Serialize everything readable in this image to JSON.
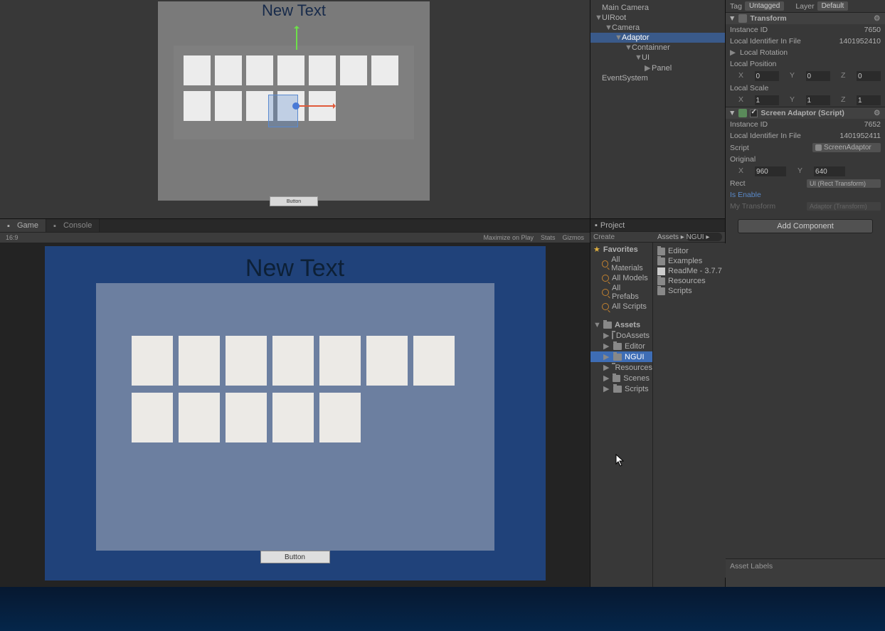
{
  "scene": {
    "title": "New Text",
    "button_label": "Button",
    "grid_rows": [
      7,
      5
    ]
  },
  "game": {
    "tabs": [
      {
        "label": "Game",
        "active": true
      },
      {
        "label": "Console",
        "active": false
      }
    ],
    "aspect": "16:9",
    "toolbar_right": [
      "Maximize on Play",
      "Stats",
      "Gizmos"
    ],
    "title": "New Text",
    "button_label": "Button",
    "grid_rows": [
      7,
      5
    ]
  },
  "hierarchy": [
    {
      "label": "Main Camera",
      "indent": 0,
      "expand": ""
    },
    {
      "label": "UIRoot",
      "indent": 0,
      "expand": "▼"
    },
    {
      "label": "Camera",
      "indent": 1,
      "expand": "▼"
    },
    {
      "label": "Adaptor",
      "indent": 2,
      "expand": "▼",
      "selected": true
    },
    {
      "label": "Containner",
      "indent": 3,
      "expand": "▼"
    },
    {
      "label": "UI",
      "indent": 4,
      "expand": "▼"
    },
    {
      "label": "Panel",
      "indent": 5,
      "expand": "▶"
    },
    {
      "label": "EventSystem",
      "indent": 0,
      "expand": ""
    }
  ],
  "project": {
    "tab": "Project",
    "create": "Create",
    "favorites_label": "Favorites",
    "favorites": [
      "All Materials",
      "All Models",
      "All Prefabs",
      "All Scripts"
    ],
    "assets_label": "Assets",
    "folders": [
      {
        "label": "DoAssets",
        "indent": 1
      },
      {
        "label": "Editor",
        "indent": 1
      },
      {
        "label": "NGUI",
        "indent": 1,
        "selected": true
      },
      {
        "label": "Resources",
        "indent": 1
      },
      {
        "label": "Scenes",
        "indent": 1
      },
      {
        "label": "Scripts",
        "indent": 1
      }
    ],
    "breadcrumb": [
      "Assets",
      "NGUI"
    ],
    "files": [
      {
        "label": "Editor",
        "type": "folder"
      },
      {
        "label": "Examples",
        "type": "folder"
      },
      {
        "label": "ReadMe - 3.7.7",
        "type": "doc"
      },
      {
        "label": "Resources",
        "type": "folder"
      },
      {
        "label": "Scripts",
        "type": "folder"
      }
    ]
  },
  "inspector": {
    "tag_label": "Tag",
    "tag_value": "Untagged",
    "layer_label": "Layer",
    "layer_value": "Default",
    "transform": {
      "header": "Transform",
      "instance_id_label": "Instance ID",
      "instance_id": "7650",
      "local_id_label": "Local Identifier In File",
      "local_id": "1401952410",
      "local_rotation_label": "Local Rotation",
      "local_position_label": "Local Position",
      "pos": {
        "x": "0",
        "y": "0",
        "z": "0"
      },
      "local_scale_label": "Local Scale",
      "scale": {
        "x": "1",
        "y": "1",
        "z": "1"
      }
    },
    "screen_adaptor": {
      "header": "Screen Adaptor (Script)",
      "instance_id_label": "Instance ID",
      "instance_id": "7652",
      "local_id_label": "Local Identifier In File",
      "local_id": "1401952411",
      "script_label": "Script",
      "script_value": "ScreenAdaptor",
      "original_label": "Original",
      "original": {
        "x": "960",
        "y": "640"
      },
      "rect_label": "Rect",
      "rect_value": "UI (Rect Transform)",
      "is_enable_label": "Is Enable",
      "my_transform_label": "My Transform",
      "my_transform_value": "Adaptor (Transform)"
    },
    "add_component": "Add Component",
    "asset_labels": "Asset Labels"
  }
}
